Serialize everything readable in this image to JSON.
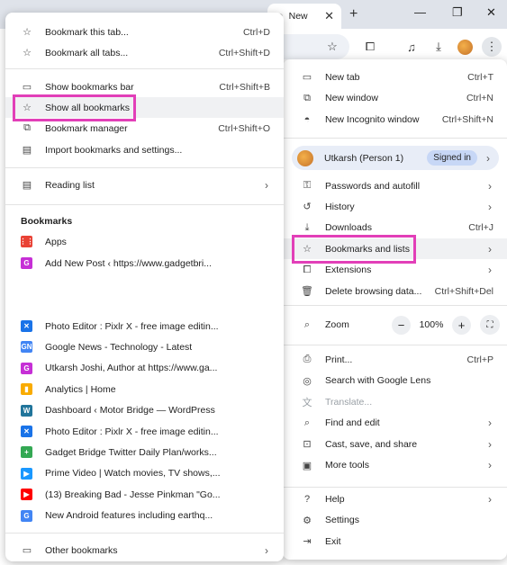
{
  "browser": {
    "active_tab_title": "New",
    "new_tab_glyph": "+",
    "close_glyph": "✕",
    "minimize_glyph": "—",
    "restore_glyph": "❐",
    "window_close_glyph": "✕"
  },
  "bookmarks_menu": {
    "top_items": [
      {
        "icon": "star-icon",
        "glyph": "☆",
        "label": "Bookmark this tab...",
        "shortcut": "Ctrl+D"
      },
      {
        "icon": "star-icon",
        "glyph": "☆",
        "label": "Bookmark all tabs...",
        "shortcut": "Ctrl+Shift+D"
      },
      {
        "icon": "bookmarks-bar-icon",
        "glyph": "▭",
        "label": "Show bookmarks bar",
        "shortcut": "Ctrl+Shift+B"
      },
      {
        "icon": "star-list-icon",
        "glyph": "☆",
        "label": "Show all bookmarks",
        "shortcut": ""
      },
      {
        "icon": "bookmark-manager-icon",
        "glyph": "⧉",
        "label": "Bookmark manager",
        "shortcut": "Ctrl+Shift+O"
      },
      {
        "icon": "import-icon",
        "glyph": "▤",
        "label": "Import bookmarks and settings...",
        "shortcut": ""
      }
    ],
    "reading_list": {
      "icon": "reading-list-icon",
      "glyph": "▤",
      "label": "Reading list",
      "chevron": "›"
    },
    "section_title": "Bookmarks",
    "bookmarks_top": [
      {
        "fav_color": "#e94235",
        "fav_text": "⋮⋮",
        "label": "Apps"
      },
      {
        "fav_color": "#c62fd6",
        "fav_text": "G",
        "label": "Add New Post ‹ https://www.gadgetbri..."
      }
    ],
    "bookmarks": [
      {
        "fav_color": "#1a73e8",
        "fav_text": "✕",
        "label": "Photo Editor : Pixlr X - free image editin..."
      },
      {
        "fav_color": "#4285f4",
        "fav_text": "GN",
        "label": "Google News - Technology - Latest"
      },
      {
        "fav_color": "#c62fd6",
        "fav_text": "G",
        "label": "Utkarsh Joshi, Author at https://www.ga..."
      },
      {
        "fav_color": "#f9ab00",
        "fav_text": "▮",
        "label": "Analytics | Home"
      },
      {
        "fav_color": "#21759b",
        "fav_text": "W",
        "label": "Dashboard ‹ Motor Bridge — WordPress"
      },
      {
        "fav_color": "#1a73e8",
        "fav_text": "✕",
        "label": "Photo Editor : Pixlr X - free image editin..."
      },
      {
        "fav_color": "#34a853",
        "fav_text": "+",
        "label": "Gadget Bridge Twitter Daily Plan/works..."
      },
      {
        "fav_color": "#1a98ff",
        "fav_text": "▶",
        "label": "Prime Video | Watch movies, TV shows,..."
      },
      {
        "fav_color": "#ff0000",
        "fav_text": "▶",
        "label": "(13) Breaking Bad - Jesse Pinkman \"Go..."
      },
      {
        "fav_color": "#4285f4",
        "fav_text": "G",
        "label": "New Android features including earthq..."
      }
    ],
    "other_bookmarks": {
      "icon": "folder-icon",
      "glyph": "▭",
      "label": "Other bookmarks",
      "chevron": "›"
    }
  },
  "main_menu": {
    "items_top": [
      {
        "icon": "new-tab-icon",
        "glyph": "▭",
        "label": "New tab",
        "shortcut": "Ctrl+T"
      },
      {
        "icon": "new-window-icon",
        "glyph": "⧉",
        "label": "New window",
        "shortcut": "Ctrl+N"
      },
      {
        "icon": "incognito-icon",
        "glyph": "◓",
        "label": "New Incognito window",
        "shortcut": "Ctrl+Shift+N"
      }
    ],
    "profile": {
      "name": "Utkarsh (Person 1)",
      "status": "Signed in",
      "chevron": "›"
    },
    "items_mid": [
      {
        "icon": "key-icon",
        "glyph": "⚿",
        "label": "Passwords and autofill",
        "shortcut": "",
        "chev": "›"
      },
      {
        "icon": "history-icon",
        "glyph": "↺",
        "label": "History",
        "shortcut": "",
        "chev": "›"
      },
      {
        "icon": "download-icon",
        "glyph": "⤓",
        "label": "Downloads",
        "shortcut": "Ctrl+J",
        "chev": ""
      },
      {
        "icon": "star-icon",
        "glyph": "☆",
        "label": "Bookmarks and lists",
        "shortcut": "",
        "chev": "›"
      },
      {
        "icon": "extensions-icon",
        "glyph": "⧠",
        "label": "Extensions",
        "shortcut": "",
        "chev": "›"
      },
      {
        "icon": "trash-icon",
        "glyph": "🗑",
        "label": "Delete browsing data...",
        "shortcut": "Ctrl+Shift+Del",
        "chev": ""
      }
    ],
    "zoom": {
      "label": "Zoom",
      "value": "100%",
      "minus": "−",
      "plus": "+",
      "fullscreen": "⛶"
    },
    "items_tools": [
      {
        "icon": "print-icon",
        "glyph": "⎙",
        "label": "Print...",
        "shortcut": "Ctrl+P",
        "chev": "",
        "disabled": false
      },
      {
        "icon": "lens-icon",
        "glyph": "◎",
        "label": "Search with Google Lens",
        "shortcut": "",
        "chev": "",
        "disabled": false
      },
      {
        "icon": "translate-icon",
        "glyph": "文",
        "label": "Translate...",
        "shortcut": "",
        "chev": "",
        "disabled": true
      },
      {
        "icon": "find-icon",
        "glyph": "⌕",
        "label": "Find and edit",
        "shortcut": "",
        "chev": "›",
        "disabled": false
      },
      {
        "icon": "cast-icon",
        "glyph": "⊡",
        "label": "Cast, save, and share",
        "shortcut": "",
        "chev": "›",
        "disabled": false
      },
      {
        "icon": "toolbox-icon",
        "glyph": "▣",
        "label": "More tools",
        "shortcut": "",
        "chev": "›",
        "disabled": false
      }
    ],
    "items_bottom": [
      {
        "icon": "help-icon",
        "glyph": "?",
        "label": "Help",
        "shortcut": "",
        "chev": "›"
      },
      {
        "icon": "settings-icon",
        "glyph": "⚙",
        "label": "Settings",
        "shortcut": "",
        "chev": ""
      },
      {
        "icon": "exit-icon",
        "glyph": "⇥",
        "label": "Exit",
        "shortcut": "",
        "chev": ""
      }
    ]
  },
  "colors": {
    "highlight": "#e23fb8",
    "signed_in_bg": "#c7d7f6"
  }
}
